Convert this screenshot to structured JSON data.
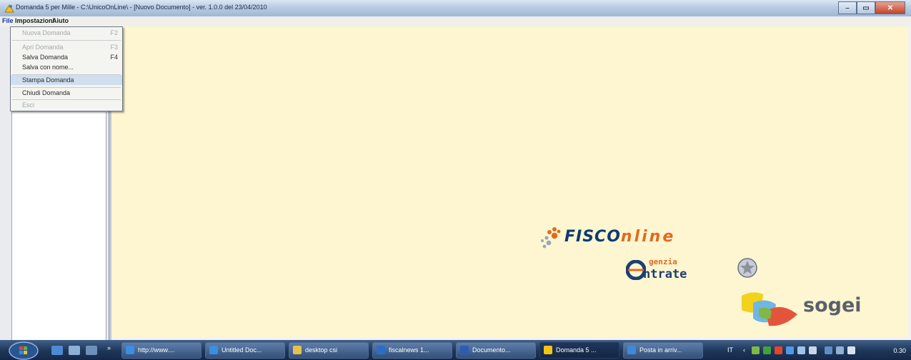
{
  "window": {
    "title": "Domanda 5 per Mille - C:\\UnicoOnLine\\ - [Nuovo Documento]  - ver. 1.0.0 del 23/04/2010"
  },
  "menu": {
    "file": "File",
    "settings": "Impostazioni",
    "help": "Aiuto"
  },
  "file_menu": {
    "items": [
      {
        "label": "Nuova Domanda",
        "shortcut": "F2",
        "enabled": false
      },
      {
        "label": "Apri Domanda",
        "shortcut": "F3",
        "enabled": false
      },
      {
        "label": "Salva Domanda",
        "shortcut": "F4",
        "enabled": true
      },
      {
        "label": "Salva con nome...",
        "shortcut": "",
        "enabled": true
      },
      {
        "label": "Stampa Domanda",
        "shortcut": "",
        "enabled": true,
        "highlighted": true
      },
      {
        "label": "Chiudi Domanda",
        "shortcut": "",
        "enabled": true
      },
      {
        "label": "Esci",
        "shortcut": "",
        "enabled": false
      }
    ]
  },
  "logos": {
    "fisconline": {
      "part1": "FISCO",
      "part2": "nline"
    },
    "agenzia": {
      "line1": "genzia",
      "line2": "ntrate"
    },
    "sogei": "sogei"
  },
  "taskbar": {
    "buttons": [
      {
        "label": "http://www....",
        "icon": "ie-icon",
        "active": false
      },
      {
        "label": "Untitled Doc...",
        "icon": "ie-icon",
        "active": false
      },
      {
        "label": "desktop csi",
        "icon": "folder-icon",
        "active": false
      },
      {
        "label": "fiscalnews 1...",
        "icon": "outlook-icon",
        "active": false
      },
      {
        "label": "Documento...",
        "icon": "word-icon",
        "active": false
      },
      {
        "label": "Domanda 5 ...",
        "icon": "app-icon",
        "active": true
      },
      {
        "label": "Posta in arriv...",
        "icon": "mail-icon",
        "active": false
      }
    ],
    "clock": "0.30",
    "lang": "IT"
  },
  "colors": {
    "workspace": "#fdf6d1",
    "taskbar": "#1e3557",
    "orange": "#e26a1f",
    "navy": "#0d3b73"
  }
}
